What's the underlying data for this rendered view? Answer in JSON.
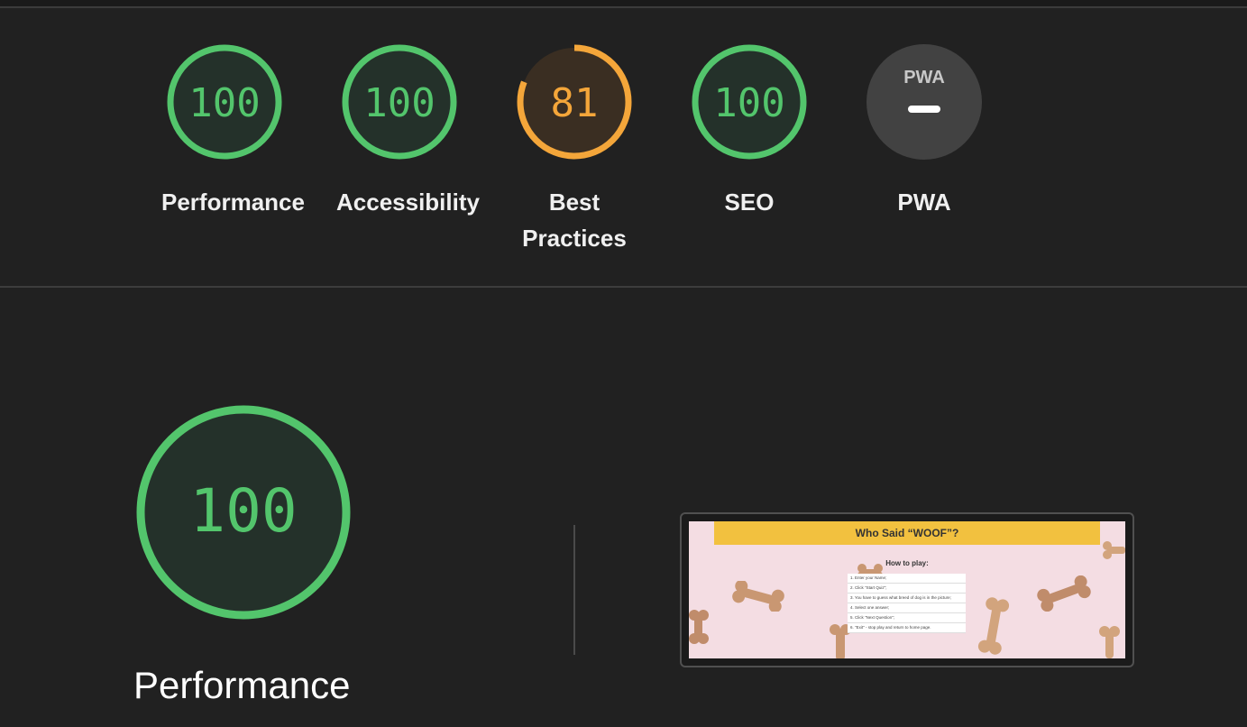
{
  "categories": [
    {
      "id": "performance",
      "score": "100",
      "label": "Performance",
      "status": "pass",
      "color": "#53c56c",
      "fill": "#24312a",
      "fraction": 1.0
    },
    {
      "id": "accessibility",
      "score": "100",
      "label": "Accessibility",
      "status": "pass",
      "color": "#53c56c",
      "fill": "#24312a",
      "fraction": 1.0
    },
    {
      "id": "best-practices",
      "score": "81",
      "label": "Best Practices",
      "status": "average",
      "color": "#f4a63a",
      "fill": "#3a2e22",
      "fraction": 0.81
    },
    {
      "id": "seo",
      "score": "100",
      "label": "SEO",
      "status": "pass",
      "color": "#53c56c",
      "fill": "#24312a",
      "fraction": 1.0
    },
    {
      "id": "pwa",
      "score": "PWA",
      "label": "PWA",
      "status": "na",
      "color": "#cccccc",
      "fill": "#424242",
      "fraction": 0
    }
  ],
  "performance_section": {
    "score": "100",
    "label": "Performance",
    "fraction": 1.0,
    "color": "#53c56c"
  },
  "screenshot": {
    "title": "Who Said “WOOF”?",
    "heading": "How to play:",
    "steps": [
      "1. Enter your Name;",
      "2. Click \"Start Quiz\";",
      "3. You have to guess what breed of dog is in the picture;",
      "4. Select one answer;",
      "5. Click \"Next Question\";",
      "6. \"Exit\" - stop play and return to home page."
    ]
  }
}
